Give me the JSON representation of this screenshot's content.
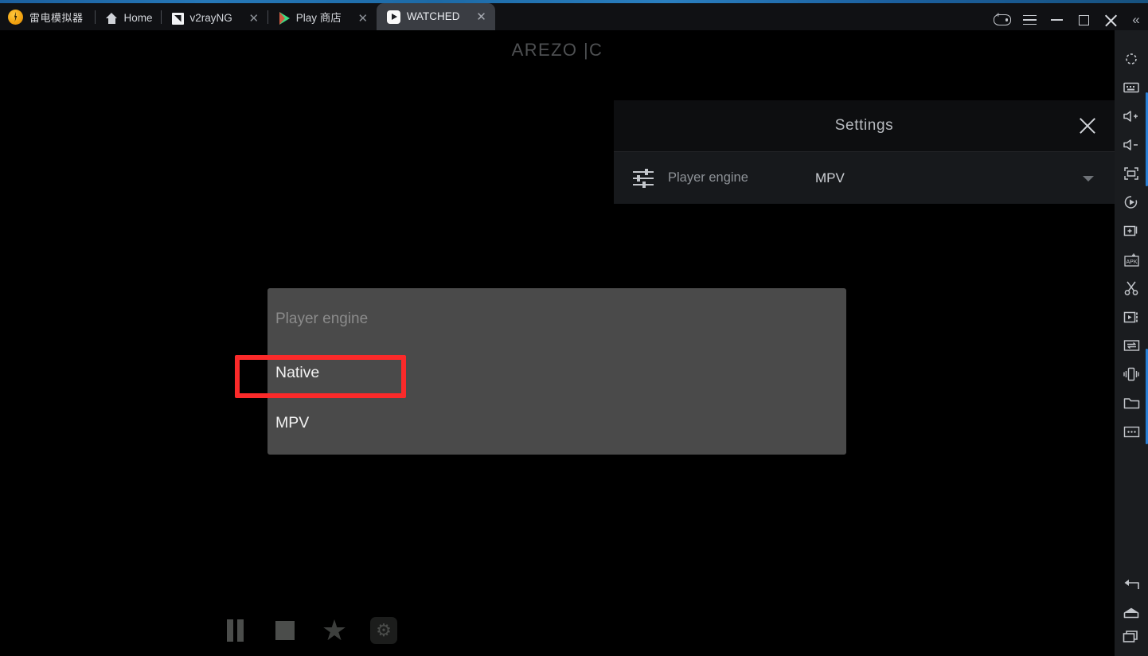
{
  "window": {
    "brand_name": "雷电模拟器",
    "tabs": [
      {
        "label": "Home",
        "icon": "home-icon",
        "close": "",
        "active": false
      },
      {
        "label": "v2rayNG",
        "icon": "v2rayng-icon",
        "close": "✕",
        "active": false
      },
      {
        "label": "Play 商店",
        "icon": "play-store-icon",
        "close": "✕",
        "active": false
      },
      {
        "label": "WATCHED",
        "icon": "watched-icon",
        "close": "✕",
        "active": true
      }
    ],
    "controls": {
      "gamepad": "gamepad-icon",
      "menu": "hamburger-menu-icon",
      "minimize": "minimize-icon",
      "maximize": "maximize-icon",
      "close": "close-icon",
      "collapse": "«"
    }
  },
  "screen": {
    "app_title": "AREZO |C"
  },
  "settings": {
    "title": "Settings",
    "close_icon": "close-icon",
    "rows": [
      {
        "icon": "tune-sliders-icon",
        "label": "Player engine",
        "value": "MPV",
        "caret": "chevron-down-icon"
      }
    ]
  },
  "dialog": {
    "title": "Player engine",
    "options": [
      {
        "label": "Native",
        "highlighted": true
      },
      {
        "label": "MPV",
        "highlighted": false
      }
    ]
  },
  "player_controls": [
    {
      "name": "pause-button",
      "icon": "pause-icon"
    },
    {
      "name": "stop-button",
      "icon": "stop-icon"
    },
    {
      "name": "favorite-button",
      "icon": "star-icon",
      "glyph": "★"
    },
    {
      "name": "settings-button",
      "icon": "gear-icon",
      "glyph": "⚙"
    }
  ],
  "sidebar": {
    "items": [
      {
        "name": "rotate-screen-icon"
      },
      {
        "name": "keyboard-icon"
      },
      {
        "name": "volume-up-icon"
      },
      {
        "name": "volume-down-icon"
      },
      {
        "name": "fullscreen-icon"
      },
      {
        "name": "macro-record-icon"
      },
      {
        "name": "new-window-icon"
      },
      {
        "name": "install-apk-icon"
      },
      {
        "name": "screenshot-scissors-icon"
      },
      {
        "name": "video-record-icon"
      },
      {
        "name": "file-transfer-icon"
      },
      {
        "name": "shake-device-icon"
      },
      {
        "name": "shared-folder-icon"
      },
      {
        "name": "more-options-icon"
      }
    ],
    "nav": [
      {
        "name": "back-nav-icon"
      },
      {
        "name": "home-nav-icon"
      },
      {
        "name": "recents-nav-icon"
      }
    ]
  },
  "colors": {
    "accent_blue": "#2a7fd4",
    "annotation_red": "#fb2a2a",
    "dialog_bg": "#4a4a4a",
    "panel_bg": "#17191c"
  }
}
